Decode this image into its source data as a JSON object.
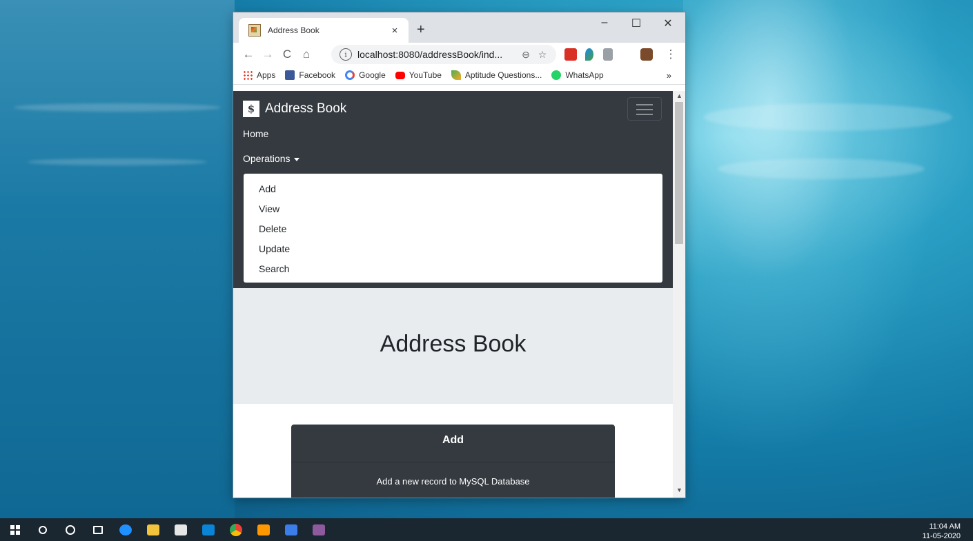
{
  "browser": {
    "tab_title": "Address Book",
    "tab_close": "×",
    "new_tab": "+",
    "minimize": "–",
    "maximize": "☐",
    "close": "✕",
    "nav": {
      "back": "←",
      "forward": "→",
      "reload": "C",
      "home": "⌂"
    },
    "url": "localhost:8080/addressBook/ind...",
    "omni_info": "i",
    "zoom_icon": "⊖",
    "star_icon": "☆",
    "menu_icon": "⋮",
    "bookmarks_more": "»",
    "bookmarks": [
      {
        "label": "Apps",
        "icon": "apps-grid-icon"
      },
      {
        "label": "Facebook",
        "icon": "facebook-icon",
        "color": "#3b5998"
      },
      {
        "label": "Google",
        "icon": "google-icon",
        "color": "#4285f4"
      },
      {
        "label": "YouTube",
        "icon": "youtube-icon",
        "color": "#ff0000"
      },
      {
        "label": "Aptitude Questions...",
        "icon": "aptitude-icon",
        "color": "#4caf50"
      },
      {
        "label": "WhatsApp",
        "icon": "whatsapp-icon",
        "color": "#25d366"
      }
    ]
  },
  "navbar": {
    "brand_logo": "$",
    "brand": "Address Book",
    "home": "Home",
    "operations": "Operations",
    "dropdown": [
      "Add",
      "View",
      "Delete",
      "Update",
      "Search"
    ]
  },
  "jumbotron": {
    "title": "Address Book"
  },
  "card": {
    "title": "Add",
    "description": "Add a new record to MySQL Database"
  },
  "taskbar": {
    "time": "11:04 AM",
    "date": "11-05-2020"
  },
  "colors": {
    "navbar_bg": "#343a40",
    "jumbotron_bg": "#e9ecef",
    "taskbar_bg": "#1a2630"
  }
}
